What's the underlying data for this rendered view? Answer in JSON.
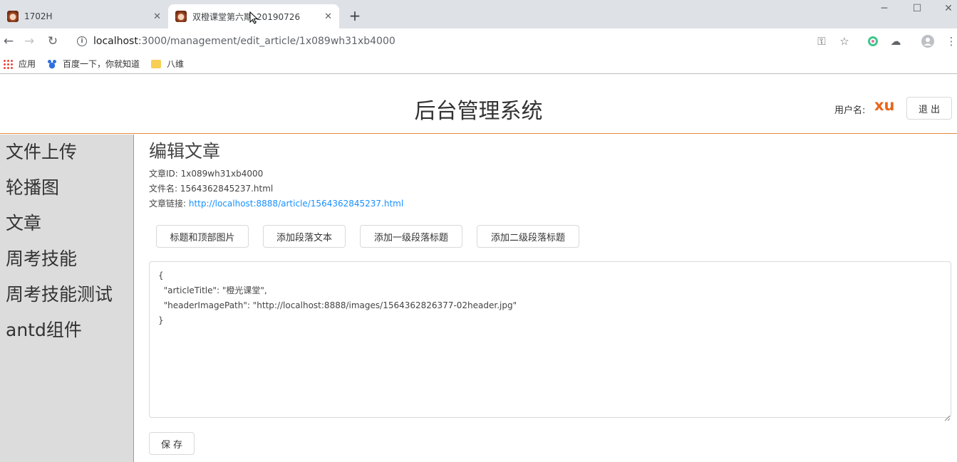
{
  "browser": {
    "tabs": [
      {
        "title": "1702H",
        "active": false
      },
      {
        "title": "双橙课堂第六期_20190726",
        "active": true
      }
    ],
    "new_tab": "+",
    "window_controls": {
      "minimize": "─",
      "maximize": "☐",
      "close": "✕"
    },
    "url_host": "localhost",
    "url_path": ":3000/management/edit_article/1x089wh31xb4000",
    "bookmarks": [
      {
        "label": "应用",
        "icon": "apps-grid-icon"
      },
      {
        "label": "百度一下，你就知道",
        "icon": "baidu-paw-icon"
      },
      {
        "label": "八维",
        "icon": "folder-icon"
      }
    ]
  },
  "header": {
    "title": "后台管理系统",
    "user_label": "用户名:",
    "user_name": "xu",
    "logout": "退出"
  },
  "sidebar": {
    "items": [
      {
        "label": "文件上传"
      },
      {
        "label": "轮播图"
      },
      {
        "label": "文章"
      },
      {
        "label": "周考技能"
      },
      {
        "label": "周考技能测试"
      },
      {
        "label": "antd组件"
      }
    ]
  },
  "main": {
    "title": "编辑文章",
    "article_id_label": "文章ID: ",
    "article_id": "1x089wh31xb4000",
    "file_name_label": "文件名: ",
    "file_name": "1564362845237.html",
    "link_label": "文章链接: ",
    "link": "http://localhost:8888/article/1564362845237.html",
    "actions": [
      {
        "label": "标题和顶部图片"
      },
      {
        "label": "添加段落文本"
      },
      {
        "label": "添加一级段落标题"
      },
      {
        "label": "添加二级段落标题"
      }
    ],
    "editor_value": "{\n  \"articleTitle\": \"橙光课堂\",\n  \"headerImagePath\": \"http://localhost:8888/images/1564362826377-02header.jpg\"\n}",
    "save": "保存"
  },
  "colors": {
    "accent_orange": "#e68a3c",
    "username_orange": "#e8661a",
    "link_blue": "#1890ff",
    "sidebar_bg": "#dcdcdc"
  }
}
